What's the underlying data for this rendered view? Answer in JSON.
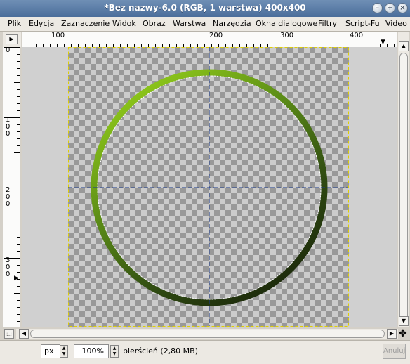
{
  "window": {
    "title": "*Bez nazwy-6.0 (RGB, 1 warstwa) 400x400"
  },
  "menubar": {
    "items": [
      "Plik",
      "Edycja",
      "Zaznaczenie",
      "Widok",
      "Obraz",
      "Warstwa",
      "Narzędzia",
      "Okna dialogowe",
      "Filtry",
      "Script-Fu",
      "Video"
    ]
  },
  "ruler": {
    "h_labels": [
      "100",
      "200",
      "300",
      "400"
    ],
    "v_labels": [
      "0",
      "100",
      "200",
      "300"
    ]
  },
  "status": {
    "unit": "px",
    "zoom": "100%",
    "message": "pierścień (2,80 MB)",
    "cancel_label": "Anuluj"
  },
  "colors": {
    "ring_light": "#8ac31a",
    "ring_dark": "#1a260a",
    "selection": "#e0d000"
  }
}
